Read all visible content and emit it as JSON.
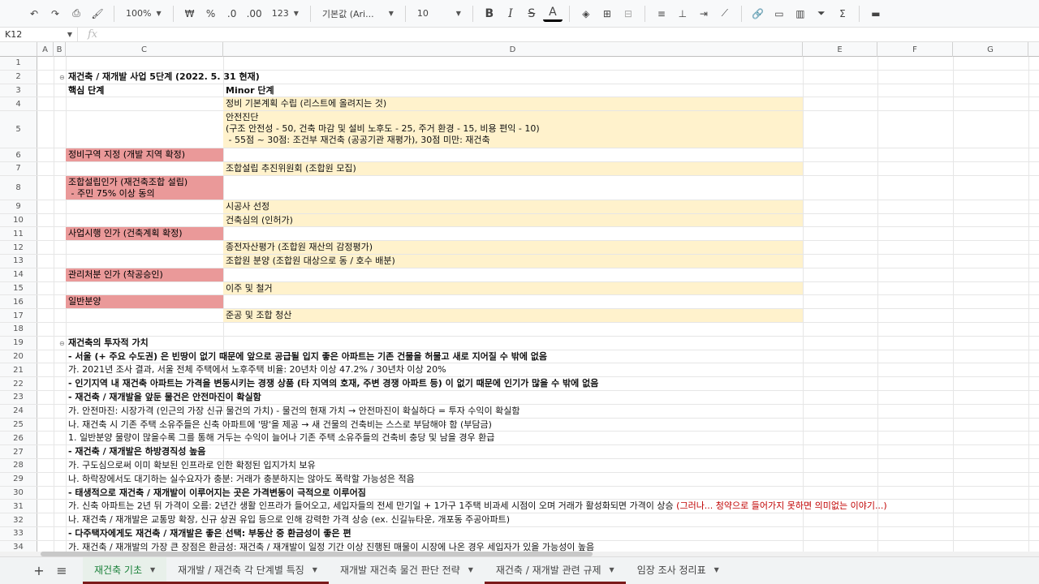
{
  "toolbar": {
    "zoom": "100%",
    "currency": "₩",
    "percent": "%",
    "dec_less": ".0",
    "dec_more": ".00",
    "format_num": "123",
    "font": "기본값 (Ari...",
    "font_size": "10"
  },
  "formula_bar": {
    "cell_ref": "K12",
    "fx": "fx",
    "content": ""
  },
  "columns": [
    "A",
    "B",
    "C",
    "D",
    "E",
    "F",
    "G"
  ],
  "rows": [
    {
      "n": "1"
    },
    {
      "n": "2",
      "text": "재건축 / 재개발 사업 5단계 (2022. 5. 31 현재)",
      "bold": true,
      "group": true
    },
    {
      "n": "3",
      "c": "핵심 단계",
      "d": "Minor 단계",
      "bold": true
    },
    {
      "n": "4",
      "d": "정비 기본계획 수립 (리스트에 올려지는 것)",
      "dfill": "cream"
    },
    {
      "n": "5",
      "d_lines": [
        "안전진단",
        "(구조 안전성 - 50, 건축 마감 및 설비 노후도 - 25, 주거 환경 - 15, 비용 편익 - 10)",
        " - 55점 ~ 30점: 조건부 재건축 (공공기관 재평가), 30점 미만: 재건축"
      ],
      "dfill": "cream"
    },
    {
      "n": "6",
      "c": "정비구역 지정 (개발 지역 확정)",
      "cfill": "pink"
    },
    {
      "n": "7",
      "d": "조합설립 추진위원회 (조합원 모집)",
      "dfill": "cream"
    },
    {
      "n": "8",
      "c_lines": [
        "조합설립인가 (재건축조합 설립)",
        " - 주민 75% 이상 동의"
      ],
      "cfill": "pink"
    },
    {
      "n": "9",
      "d": "시공사 선정",
      "dfill": "cream"
    },
    {
      "n": "10",
      "d": "건축심의 (인허가)",
      "dfill": "cream"
    },
    {
      "n": "11",
      "c": "사업시행 인가 (건축계획 확정)",
      "cfill": "pink"
    },
    {
      "n": "12",
      "d": "종전자산평가 (조합원 재산의 감정평가)",
      "dfill": "cream"
    },
    {
      "n": "13",
      "d": "조합원 분양 (조합원 대상으로 동 / 호수 배분)",
      "dfill": "cream"
    },
    {
      "n": "14",
      "c": "관리처분 인가 (착공승인)",
      "cfill": "pink"
    },
    {
      "n": "15",
      "d": "이주 및 철거",
      "dfill": "cream"
    },
    {
      "n": "16",
      "c": "일반분양",
      "cfill": "pink"
    },
    {
      "n": "17",
      "d": "준공 및 조합 청산",
      "dfill": "cream"
    },
    {
      "n": "18"
    },
    {
      "n": "19",
      "text": "재건축의 투자적 가치",
      "bold": true,
      "group": true
    },
    {
      "n": "20",
      "text": "- 서울 (+ 주요 수도권) 은 빈땅이 없기 때문에 앞으로 공급될 입지 좋은 아파트는 기존 건물을 허물고 새로 지어질 수 밖에 없음",
      "bold": true
    },
    {
      "n": "21",
      "text": "   가. 2021년 조사 결과, 서울 전체 주택에서 노후주택 비율: 20년차 이상 47.2% / 30년차 이상 20%"
    },
    {
      "n": "22",
      "text": "- 인기지역 내 재건축 아파트는 가격을 변동시키는 경쟁 상품 (타 지역의 호재, 주변 경쟁 아파트 등) 이 없기 때문에 인기가 많을 수 밖에 없음",
      "bold": true
    },
    {
      "n": "23",
      "text": "- 재건축 / 재개발을 앞둔 물건은 안전마진이 확실함",
      "bold": true
    },
    {
      "n": "24",
      "text": "   가. 안전마진: 시장가격 (인근의 가장 신규 물건의 가치) - 물건의 현재 가치 → 안전마진이 확실하다 = 투자 수익이 확실함"
    },
    {
      "n": "25",
      "text": "   나. 재건축 시 기존 주택 소유주들은 신축 아파트에 '땅'을 제공 → 새 건물의 건축비는 스스로 부담해야 함 (부담금)"
    },
    {
      "n": "26",
      "text": "         1. 일반분양 물량이 많을수록 그를 통해 거두는 수익이 늘어나 기존 주택 소유주들의 건축비 충당 및 남을 경우 환급"
    },
    {
      "n": "27",
      "text": "- 재건축 / 재개발은 하방경직성 높음",
      "bold": true
    },
    {
      "n": "28",
      "text": "   가. 구도심으로써 이미 확보된 인프라로 인한 확정된 입지가치 보유"
    },
    {
      "n": "29",
      "text": "   나. 하락장에서도 대기하는 실수요자가 충분: 거래가 충분하지는 않아도 폭락할 가능성은 적음"
    },
    {
      "n": "30",
      "text": "- 태생적으로 재건축 / 재개발이 이루어지는 곳은 가격변동이 극적으로 이루어짐",
      "bold": true
    },
    {
      "n": "31",
      "text": "   가. 신축 아파트는 2년 뒤 가격이 오름: 2년간 생활 인프라가 들어오고, 세입자들의 전세 만기일 + 1가구 1주택 비과세 시점이 오며 거래가 활성화되면 가격이 상승 ",
      "red": "(그러나... 청약으로 들어가지 못하면 의미없는 이야기...)"
    },
    {
      "n": "32",
      "text": "   나. 재건축 / 재개발은 교통망 확장, 신규 상권 유입 등으로 인해 강력한 가격 상승 (ex. 신길뉴타운, 개포동 주공아파트)"
    },
    {
      "n": "33",
      "text": "- 다주택자에게도 재건축 / 재개발은 좋은 선택: 부동산 중 환금성이 좋은 편",
      "bold": true
    },
    {
      "n": "34",
      "text": "   가. 재건축 / 재개발의 가장 큰 장점은 환금성: 재건축 / 재개발이 일정 기간 이상 진행된 매물이 시장에 나온 경우 세입자가 있을 가능성이 높음"
    }
  ],
  "sheet_tabs": [
    {
      "label": "재건축 기초",
      "active": true
    },
    {
      "label": "재개발 / 재건축 각 단계별 특징",
      "active": false
    },
    {
      "label": "재개발 재건축 물건 판단 전략",
      "active": false
    },
    {
      "label": "재건축 / 재개발 관련 규제",
      "active": false,
      "mark": true
    },
    {
      "label": "임장 조사 정리표",
      "active": false
    }
  ]
}
